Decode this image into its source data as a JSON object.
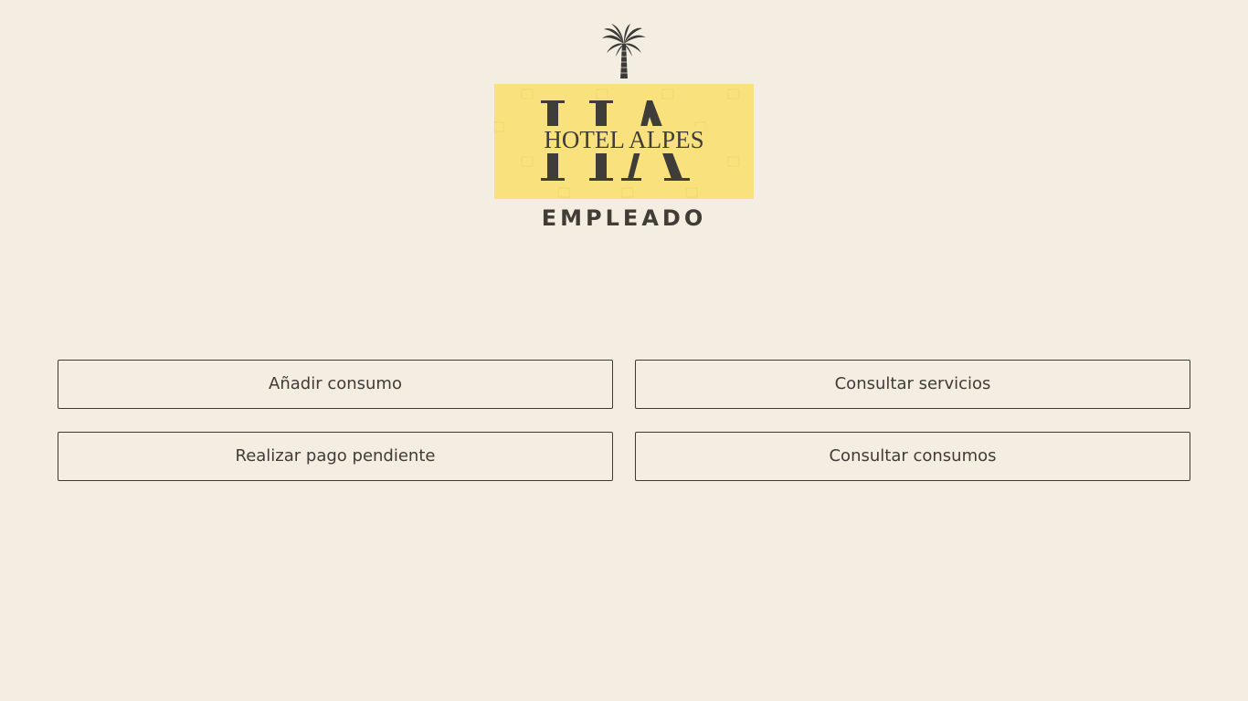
{
  "logo": {
    "brand_name": "HOTEL ALPES",
    "monogram": "HA",
    "icon": "palm-tree-icon",
    "background_color": "#f9e27d"
  },
  "role_title": "EMPLEADO",
  "actions": [
    {
      "label": "Añadir consumo"
    },
    {
      "label": "Consultar servicios"
    },
    {
      "label": "Realizar pago pendiente"
    },
    {
      "label": "Consultar consumos"
    }
  ],
  "colors": {
    "background": "#f3ede2",
    "text": "#3f3c37",
    "border": "#3c3a36",
    "logo_yellow": "#f9e27d"
  }
}
